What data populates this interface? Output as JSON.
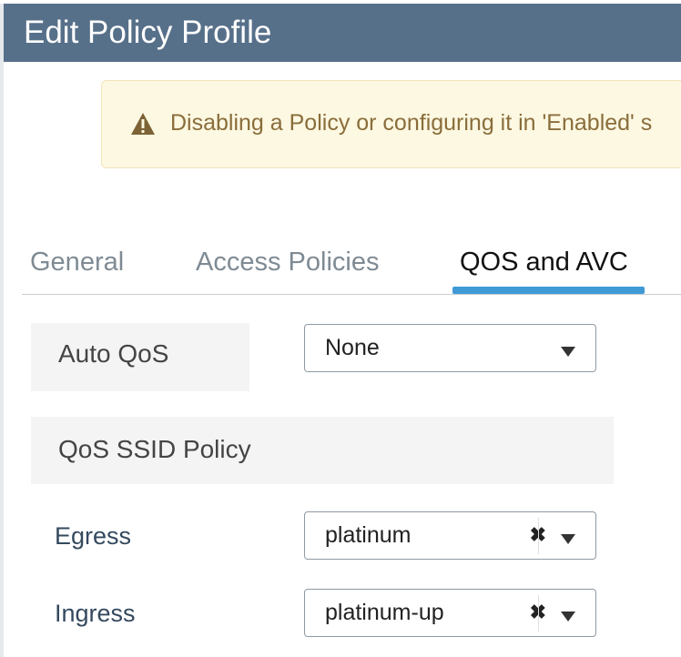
{
  "header": {
    "title": "Edit Policy Profile"
  },
  "warning": {
    "icon": "warning-triangle-icon",
    "text": "Disabling a Policy or configuring it in 'Enabled' s"
  },
  "tabs": [
    {
      "label": "General",
      "active": false
    },
    {
      "label": "Access Policies",
      "active": false
    },
    {
      "label": "QOS and AVC",
      "active": true
    }
  ],
  "auto_qos": {
    "label": "Auto QoS",
    "value": "None"
  },
  "qos_ssid_policy": {
    "heading": "QoS SSID Policy",
    "egress": {
      "label": "Egress",
      "value": "platinum"
    },
    "ingress": {
      "label": "Ingress",
      "value": "platinum-up"
    }
  },
  "colors": {
    "header_bg": "#57708a",
    "tab_accent": "#3f9ad6",
    "warning_bg": "#fcf8e2",
    "warning_text": "#8a6d3b"
  }
}
